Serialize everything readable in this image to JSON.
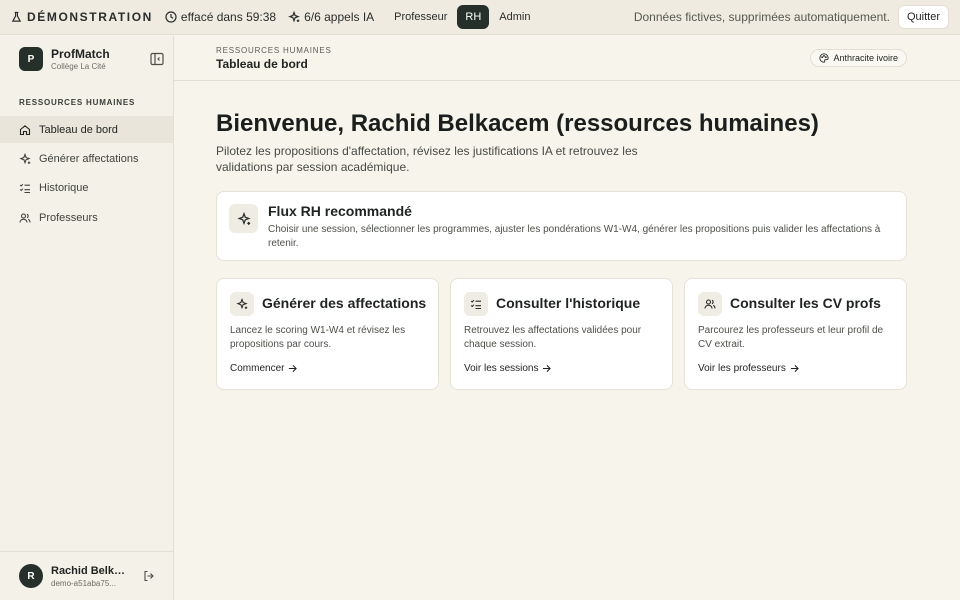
{
  "topbar": {
    "demo_label": "DÉMONSTRATION",
    "timer": "effacé dans 59:38",
    "ai_calls": "6/6 appels IA",
    "roles": [
      {
        "label": "Professeur",
        "active": false
      },
      {
        "label": "RH",
        "active": true
      },
      {
        "label": "Admin",
        "active": false
      }
    ],
    "notice": "Données fictives, supprimées automatiquement.",
    "quit_label": "Quitter"
  },
  "brand": {
    "logo_letter": "P",
    "name": "ProfMatch",
    "subtitle": "Collège La Cité"
  },
  "sidebar": {
    "section_label": "RESSOURCES HUMAINES",
    "items": [
      {
        "label": "Tableau de bord",
        "icon": "home-icon",
        "active": true
      },
      {
        "label": "Générer affectations",
        "icon": "sparkles-icon",
        "active": false
      },
      {
        "label": "Historique",
        "icon": "list-checks-icon",
        "active": false
      },
      {
        "label": "Professeurs",
        "icon": "users-icon",
        "active": false
      }
    ]
  },
  "user": {
    "initial": "R",
    "name": "Rachid Belkacem",
    "id": "demo-a51aba75..."
  },
  "header": {
    "section": "RESSOURCES HUMAINES",
    "title": "Tableau de bord",
    "theme_label": "Anthracite ivoire"
  },
  "main": {
    "heading": "Bienvenue, Rachid Belkacem (ressources humaines)",
    "intro": "Pilotez les propositions d'affectation, révisez les justifications IA et retrouvez les validations par session académique.",
    "flux": {
      "title": "Flux RH recommandé",
      "description": "Choisir une session, sélectionner les programmes, ajuster les pondérations W1-W4, générer les propositions puis valider les affectations à retenir."
    },
    "cards": [
      {
        "title": "Générer des affectations",
        "description": "Lancez le scoring W1-W4 et révisez les propositions par cours.",
        "link": "Commencer",
        "icon": "sparkles-icon"
      },
      {
        "title": "Consulter l'historique",
        "description": "Retrouvez les affectations validées pour chaque session.",
        "link": "Voir les sessions",
        "icon": "list-checks-icon"
      },
      {
        "title": "Consulter les CV profs",
        "description": "Parcourez les professeurs et leur profil de CV extrait.",
        "link": "Voir les professeurs",
        "icon": "users-icon"
      }
    ]
  },
  "colors": {
    "accent": "#243029",
    "background": "#f7f4ec",
    "surface": "#ffffff"
  }
}
